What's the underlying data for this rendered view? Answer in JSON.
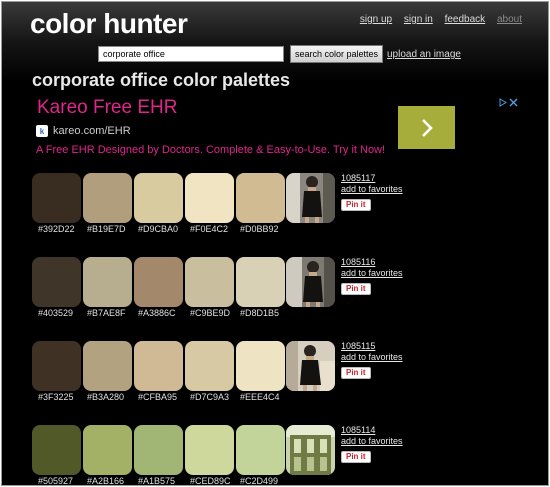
{
  "header": {
    "logo": "color hunter",
    "nav": {
      "sign_up": "sign up",
      "sign_in": "sign in",
      "feedback": "feedback",
      "about": "about"
    }
  },
  "search": {
    "value": "corporate office",
    "button_label": "search color palettes",
    "upload_label": "upload an image"
  },
  "page_title": "corporate office color palettes",
  "ad": {
    "title": "Kareo Free EHR",
    "url": "kareo.com/EHR",
    "description": "A Free EHR Designed by Doctors. Complete & Easy-to-Use. Try it Now!",
    "accent_color": "#a7ad3b",
    "text_color": "#e0258c"
  },
  "palettes": [
    {
      "id": "1085117",
      "add_label": "add to favorites",
      "pin_label": "Pin it",
      "thumb": "photo-woman-in-dark-dress",
      "colors": [
        "#392D22",
        "#B19E7D",
        "#D9CBA0",
        "#F0E4C2",
        "#D0BB92"
      ]
    },
    {
      "id": "1085116",
      "add_label": "add to favorites",
      "pin_label": "Pin it",
      "thumb": "photo-woman-in-dark-dress",
      "colors": [
        "#403529",
        "#B7AE8F",
        "#A3886C",
        "#C9BE9D",
        "#D8D1B5"
      ]
    },
    {
      "id": "1085115",
      "add_label": "add to favorites",
      "pin_label": "Pin it",
      "thumb": "photo-woman-in-dark-dress",
      "colors": [
        "#3F3225",
        "#B3A280",
        "#CFBA95",
        "#D7C9A3",
        "#EEE4C4"
      ]
    },
    {
      "id": "1085114",
      "add_label": "add to favorites",
      "pin_label": "Pin it",
      "thumb": "photo-building-facade",
      "colors": [
        "#505927",
        "#A2B166",
        "#A1B575",
        "#CED89C",
        "#C2D499"
      ]
    }
  ]
}
